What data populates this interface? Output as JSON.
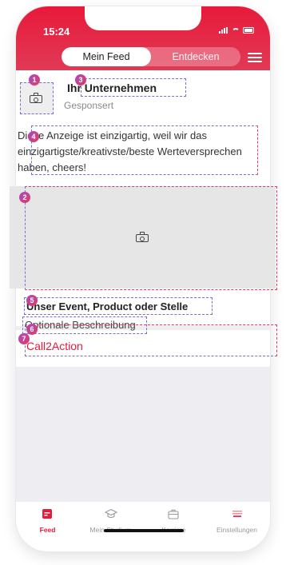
{
  "status_bar": {
    "time": "15:24"
  },
  "header": {
    "tabs": [
      {
        "label": "Mein Feed",
        "active": true
      },
      {
        "label": "Entdecken",
        "active": false
      }
    ],
    "menu_icon": "hamburger-menu-icon",
    "brand_color": "#e8193a"
  },
  "ad": {
    "company": "Ihr Unternehmen",
    "sponsored": "Gesponsert",
    "description": "Diese Anzeige ist einzigartig, weil wir das einzigartigste/kreativste/beste Werteversprechen haben, cheers!",
    "event_title": "Unser Event, Product oder Stelle",
    "event_description": "Optionale Beschreibung",
    "cta": "Call2Action",
    "badges": [
      "1",
      "2",
      "3",
      "4",
      "5",
      "6",
      "7"
    ]
  },
  "tabbar": {
    "items": [
      {
        "label": "Feed",
        "icon": "feed-icon",
        "active": true
      },
      {
        "label": "Mein Studium",
        "icon": "graduation-cap-icon",
        "active": false
      },
      {
        "label": "Karriere",
        "icon": "briefcase-icon",
        "active": false
      },
      {
        "label": "Einstellungen",
        "icon": "university-logo-icon",
        "active": false
      }
    ]
  }
}
